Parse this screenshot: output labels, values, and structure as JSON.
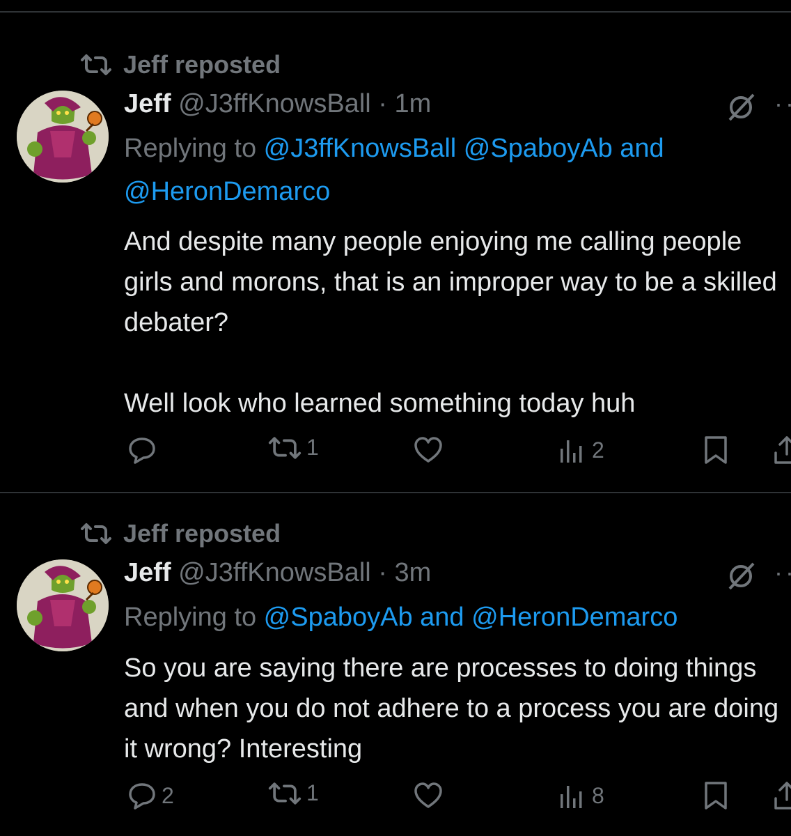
{
  "tweets": [
    {
      "repost_label": "Jeff reposted",
      "name": "Jeff",
      "handle": "@J3ffKnowsBall",
      "time": "· 1m",
      "replying_prefix": "Replying to ",
      "reply_mentions_line1": "@J3ffKnowsBall @SpaboyAb and",
      "reply_mentions_line2": "@HeronDemarco",
      "text_p1": "And despite many people enjoying me calling people girls and morons, that is an improper way to be a skilled debater?",
      "text_p2": "Well look who learned something today huh",
      "counts": {
        "replies": "",
        "reposts": "1",
        "likes": "",
        "views": "2"
      }
    },
    {
      "repost_label": "Jeff reposted",
      "name": "Jeff",
      "handle": "@J3ffKnowsBall",
      "time": "· 3m",
      "replying_prefix": "Replying to ",
      "reply_mentions_line1": "@SpaboyAb and @HeronDemarco",
      "text_p1": "So you are saying there are processes to doing things and when you do not adhere to a process you are doing it wrong? Interesting",
      "counts": {
        "replies": "2",
        "reposts": "1",
        "likes": "",
        "views": "8"
      }
    }
  ],
  "icons": {
    "repost": "repost-icon",
    "reply": "reply-icon",
    "like": "heart-icon",
    "views": "views-icon",
    "bookmark": "bookmark-icon",
    "share": "share-icon",
    "grok": "grok-icon",
    "more": "more-icon"
  },
  "colors": {
    "background": "#000000",
    "text": "#e7e9ea",
    "muted": "#71767b",
    "mention": "#1d9bf0",
    "divider": "#2f3336"
  }
}
